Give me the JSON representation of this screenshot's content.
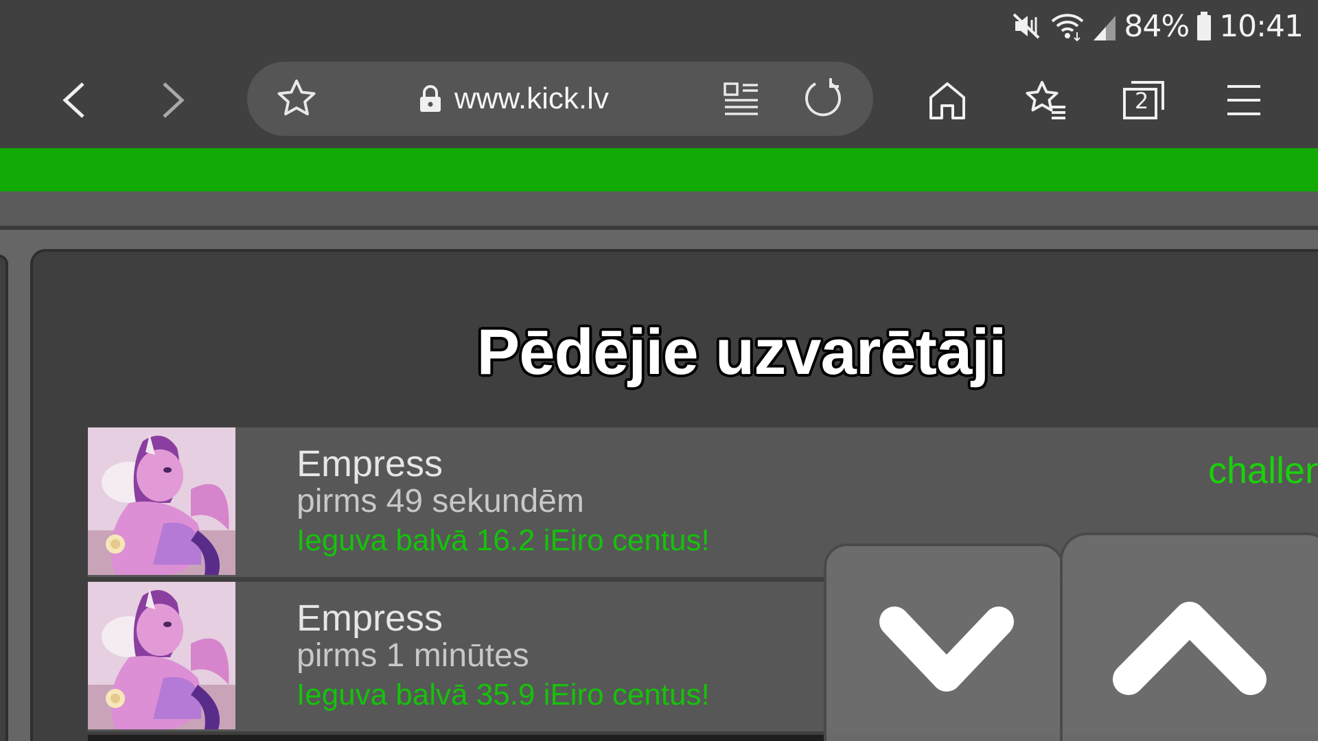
{
  "status_bar": {
    "battery_percent": "84%",
    "time": "10:41",
    "icons": [
      "mute-vibrate-icon",
      "wifi-icon",
      "signal-icon",
      "battery-icon"
    ]
  },
  "toolbar": {
    "url": "www.kick.lv",
    "tab_count": "2",
    "icons": [
      "back-icon",
      "forward-icon",
      "bookmark-star-icon",
      "lock-icon",
      "reader-mode-icon",
      "reload-icon",
      "home-icon",
      "bookmarks-icon",
      "tabs-icon",
      "menu-icon"
    ]
  },
  "colors": {
    "accent_green": "#12aa04",
    "prize_green": "#15c20b",
    "background": "#3f3f3f"
  },
  "page": {
    "title": "Pēdējie uzvarētāji",
    "winners": [
      {
        "name": "Empress",
        "time": "pirms 49 sekundēm",
        "prize": "Ieguva balvā 16.2 iEiro centus!",
        "tag": "challen"
      },
      {
        "name": "Empress",
        "time": "pirms 1 minūtes",
        "prize": "Ieguva balvā 35.9 iEiro centus!",
        "tag": ""
      }
    ]
  }
}
